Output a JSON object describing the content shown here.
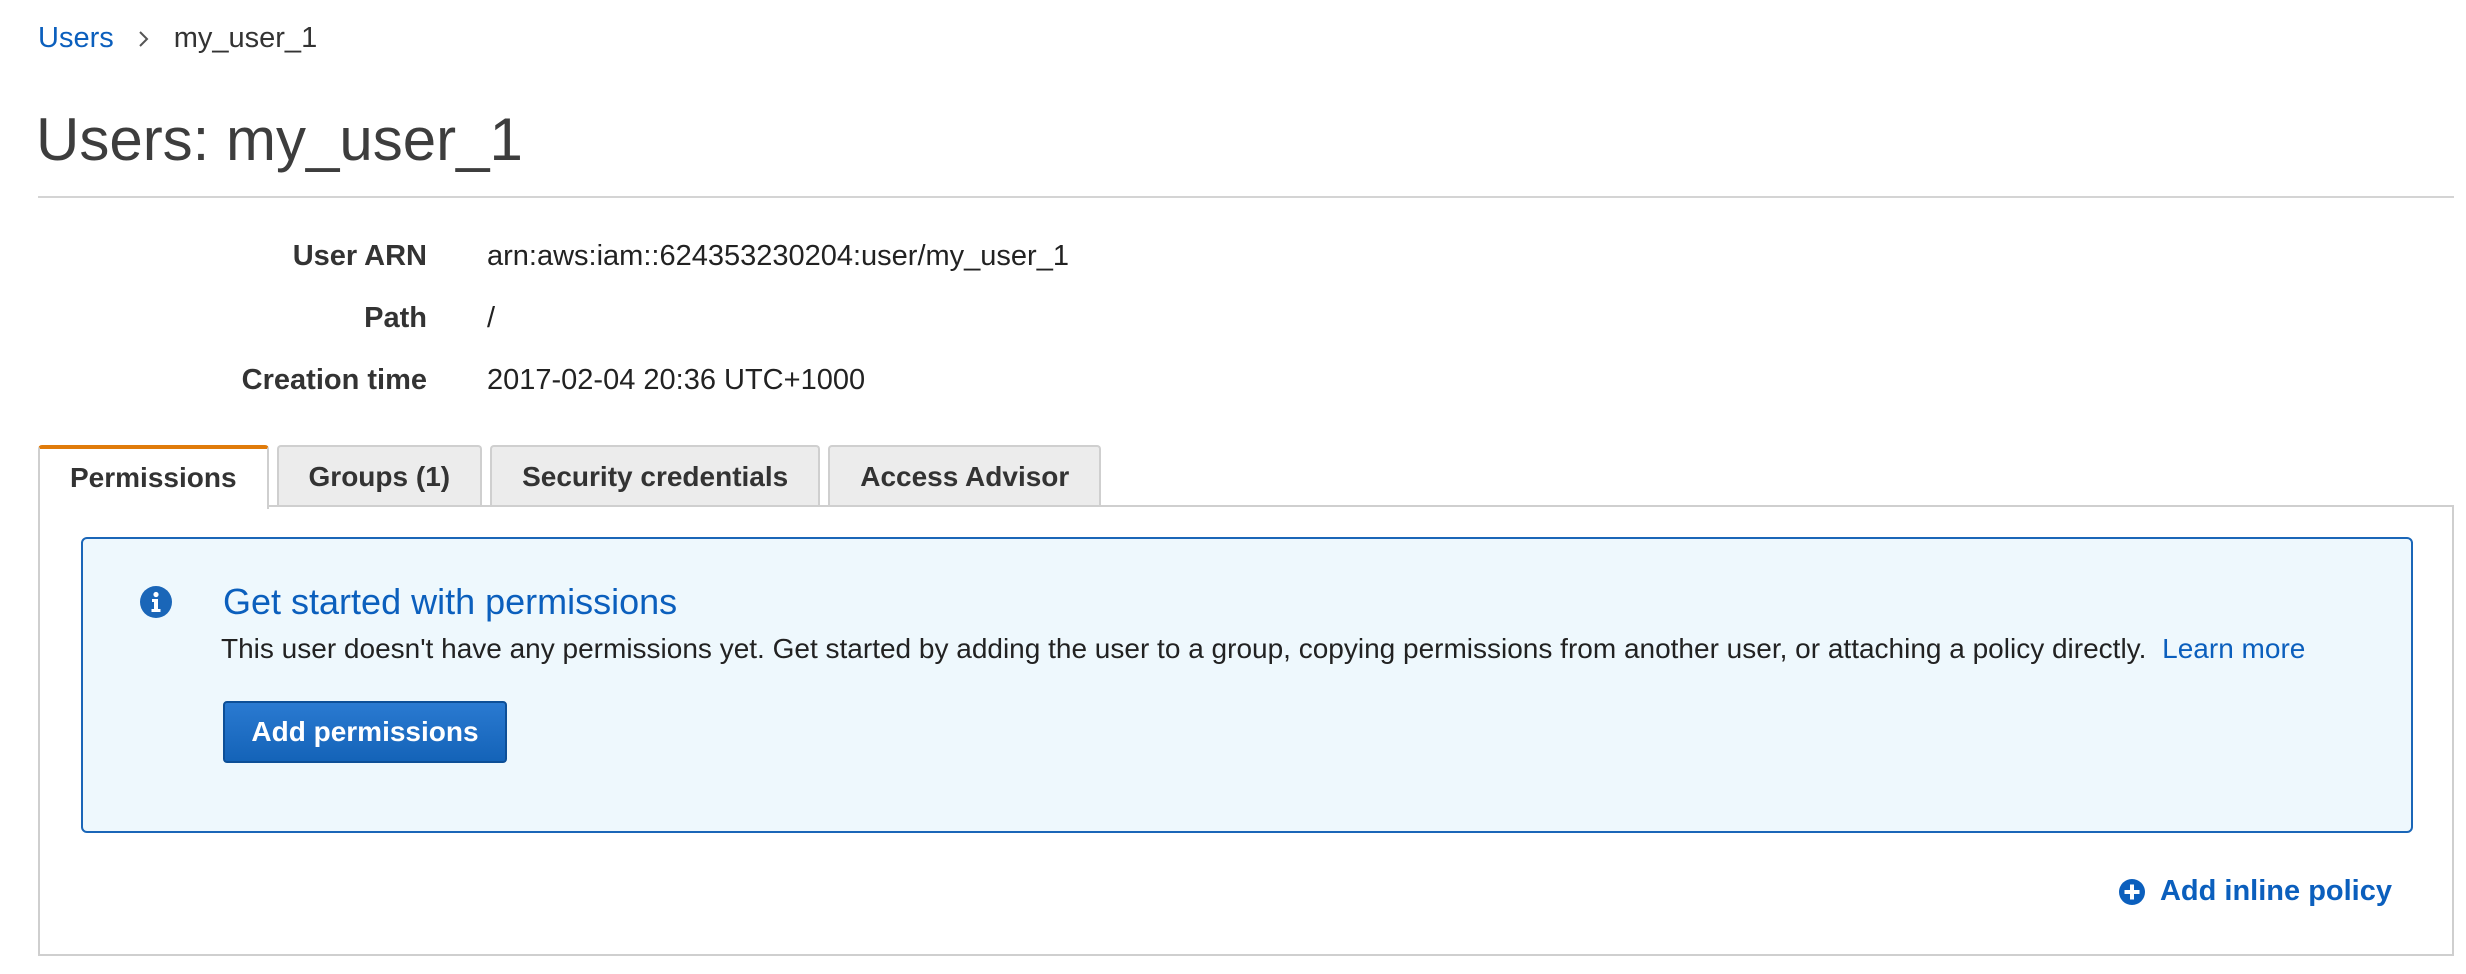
{
  "breadcrumb": {
    "parent": "Users",
    "separator_icon": "chevron-right-icon",
    "current": "my_user_1"
  },
  "page": {
    "title": "Users: my_user_1"
  },
  "summary": {
    "rows": [
      {
        "label": "User ARN",
        "value": "arn:aws:iam::624353230204:user/my_user_1"
      },
      {
        "label": "Path",
        "value": "/"
      },
      {
        "label": "Creation time",
        "value": "2017-02-04 20:36 UTC+1000"
      }
    ]
  },
  "tabs": [
    {
      "label": "Permissions",
      "active": true
    },
    {
      "label": "Groups (1)",
      "active": false
    },
    {
      "label": "Security credentials",
      "active": false
    },
    {
      "label": "Access Advisor",
      "active": false
    }
  ],
  "permissions_panel": {
    "alert": {
      "icon": "info-icon",
      "title": "Get started with permissions",
      "body": "This user doesn't have any permissions yet. Get started by adding the user to a group, copying permissions from another user, or attaching a policy directly.",
      "link": "Learn more",
      "button_label": "Add permissions"
    },
    "inline_policy": {
      "icon": "plus-circle-icon",
      "label": "Add inline policy"
    }
  },
  "colors": {
    "link": "#0b5fbd",
    "active_tab_accent": "#e07b0a",
    "alert_background": "#eef8fd",
    "alert_border": "#1a66b8",
    "primary_button": "#1f6fc6"
  }
}
